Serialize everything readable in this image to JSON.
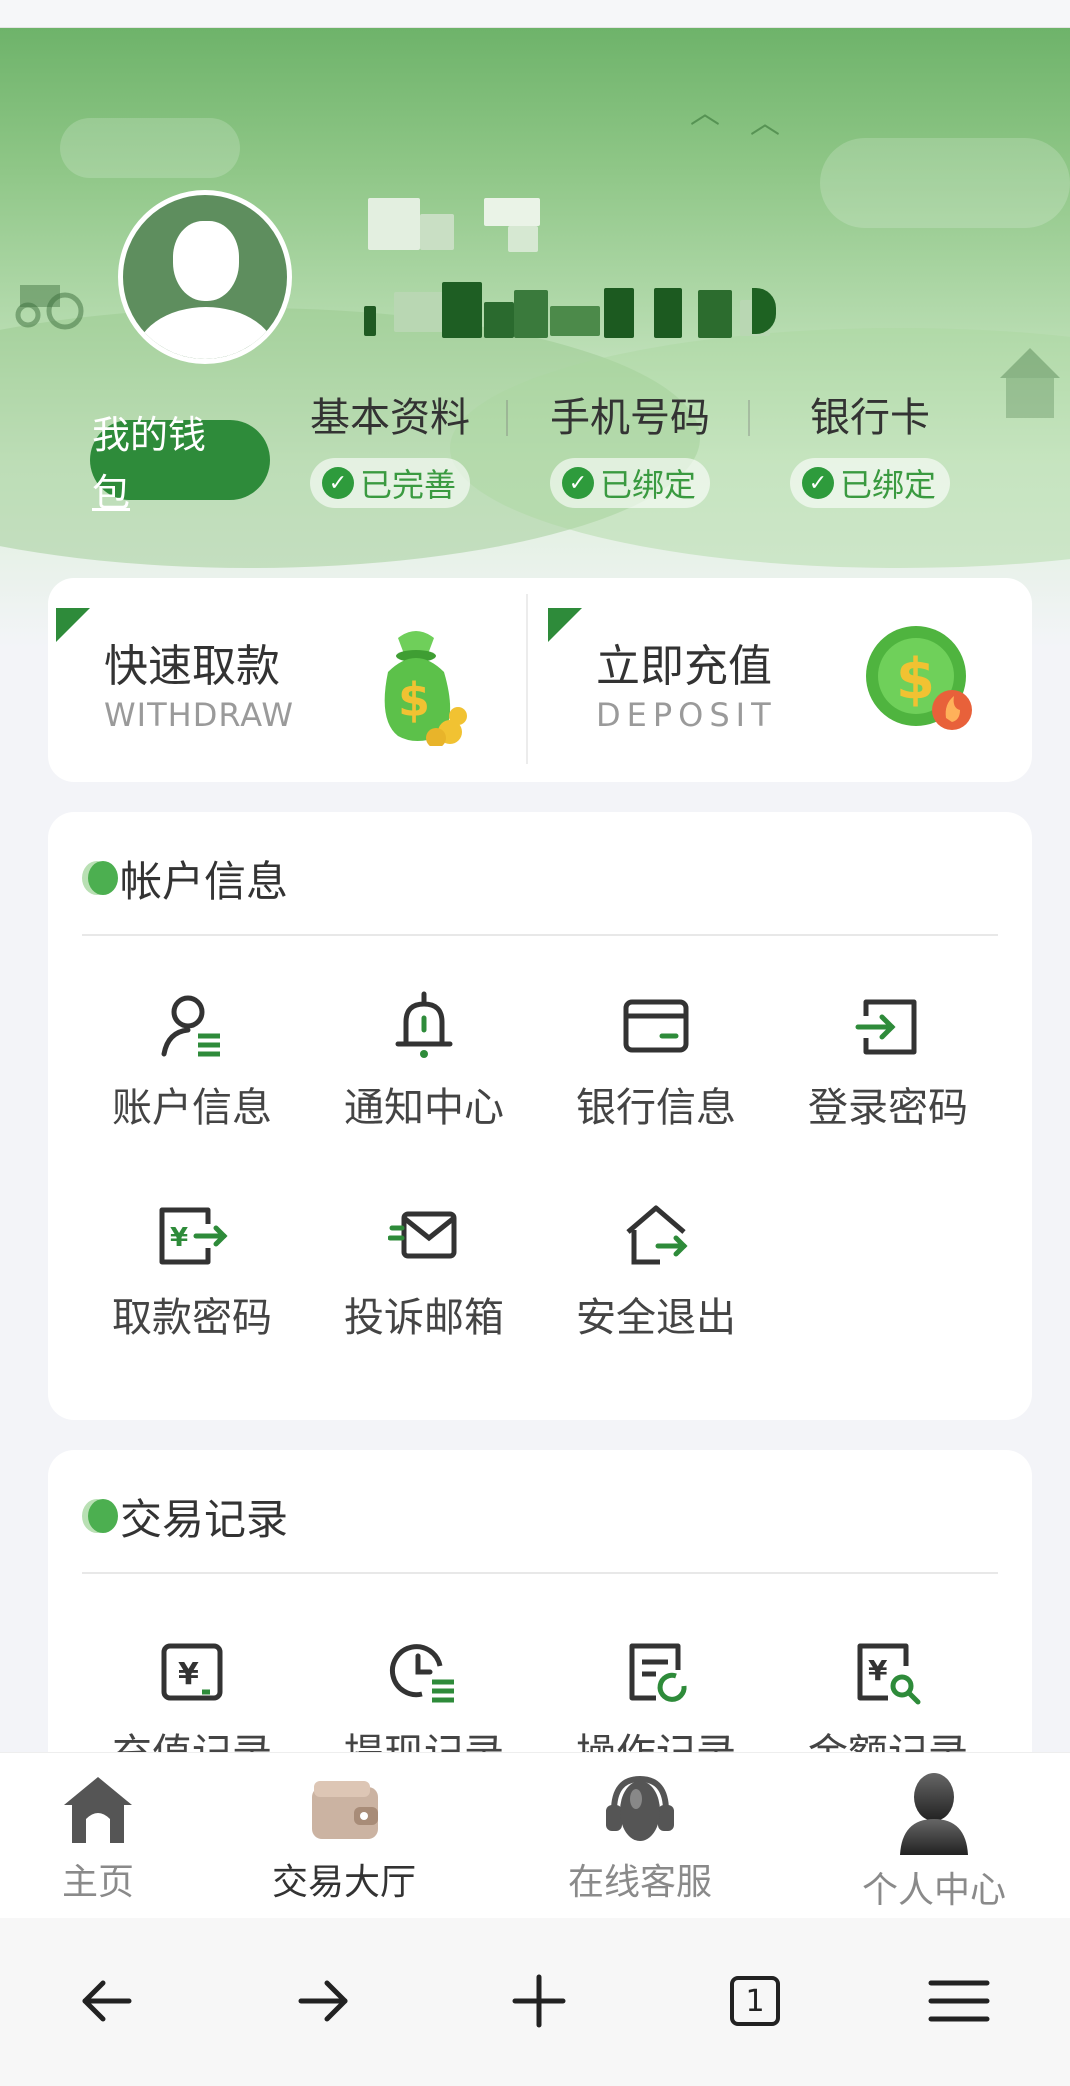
{
  "header": {
    "wallet_label_line1": "我的钱",
    "wallet_label_line2": "包",
    "status_items": [
      {
        "label": "基本资料",
        "status": "已完善"
      },
      {
        "label": "手机号码",
        "status": "已绑定"
      },
      {
        "label": "银行卡",
        "status": "已绑定"
      }
    ]
  },
  "quick_actions": [
    {
      "title": "快速取款",
      "subtitle": "WITHDRAW"
    },
    {
      "title": "立即充值",
      "subtitle": "DEPOSIT"
    }
  ],
  "account_section": {
    "title": "帐户信息",
    "items": [
      "账户信息",
      "通知中心",
      "银行信息",
      "登录密码",
      "取款密码",
      "投诉邮箱",
      "安全退出"
    ]
  },
  "records_section": {
    "title": "交易记录",
    "items": [
      "充值记录",
      "提现记录",
      "操作记录",
      "金额记录"
    ]
  },
  "tabbar": {
    "items": [
      {
        "label": "主页"
      },
      {
        "label": "交易大厅"
      },
      {
        "label": "在线客服"
      },
      {
        "label": "个人中心"
      }
    ]
  },
  "browser_bar": {
    "tab_count": "1"
  },
  "colors": {
    "brand_green": "#2e8b3a",
    "accent_green": "#2e9b3c"
  }
}
